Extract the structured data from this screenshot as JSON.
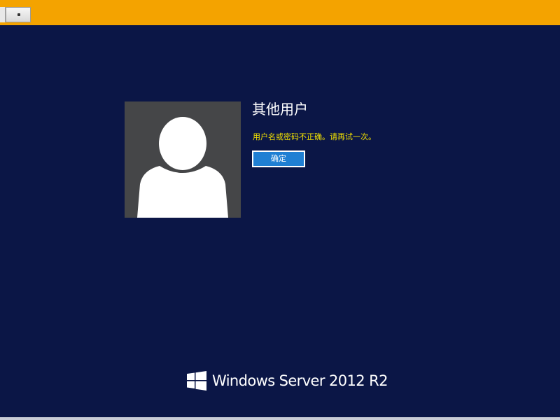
{
  "topbar": {
    "color": "#f4a300"
  },
  "login": {
    "user_label": "其他用户",
    "error_message": "用户名或密码不正确。请再试一次。",
    "ok_button_label": "确定",
    "avatar_icon": "default-user-icon"
  },
  "branding": {
    "logo_icon": "windows-logo-icon",
    "product_name": "Windows Server 2012 R2"
  },
  "colors": {
    "background": "#0b1646",
    "error_text": "#f2e100",
    "button": "#1f7fd3",
    "avatar_bg": "#454648"
  }
}
